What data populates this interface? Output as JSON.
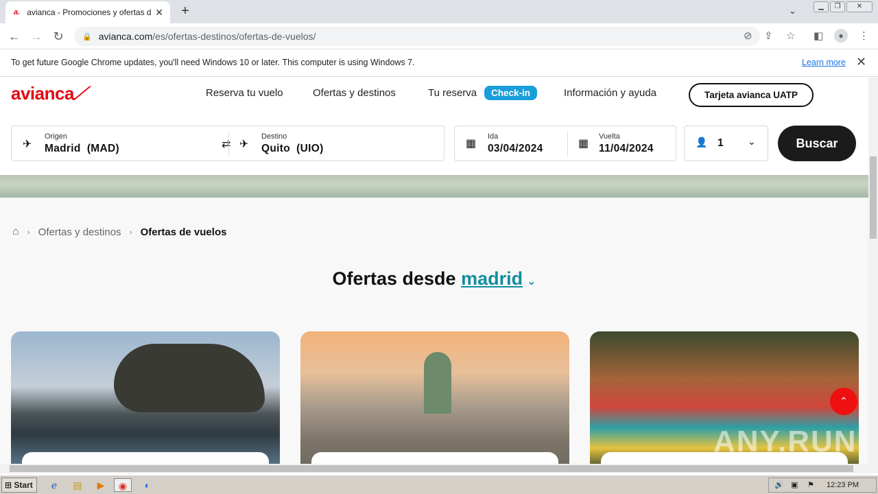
{
  "browser": {
    "tab_title": "avianca - Promociones y ofertas de",
    "favicon_text": "a.",
    "new_tab": "+",
    "url_domain": "avianca.com",
    "url_path": "/es/ofertas-destinos/ofertas-de-vuelos/"
  },
  "infobar": {
    "message": "To get future Google Chrome updates, you'll need Windows 10 or later. This computer is using Windows 7.",
    "learn_more": "Learn more"
  },
  "header": {
    "logo": "avianca",
    "nav": [
      "Reserva tu vuelo",
      "Ofertas y destinos",
      "Tu reserva",
      "Información y ayuda"
    ],
    "checkin": "Check-in",
    "uatp": "Tarjeta avianca UATP"
  },
  "search": {
    "origin_label": "Origen",
    "origin_value": "Madrid  (MAD)",
    "dest_label": "Destino",
    "dest_value": "Quito  (UIO)",
    "depart_label": "Ida",
    "depart_value": "03/04/2024",
    "return_label": "Vuelta",
    "return_value": "11/04/2024",
    "passengers": "1",
    "button": "Buscar"
  },
  "breadcrumb": {
    "level1": "Ofertas y destinos",
    "current": "Ofertas de vuelos"
  },
  "offers": {
    "title_prefix": "Ofertas desde",
    "city": "madrid"
  },
  "watermark": "ANY.RUN",
  "taskbar": {
    "start": "Start",
    "time": "12:23 PM"
  }
}
